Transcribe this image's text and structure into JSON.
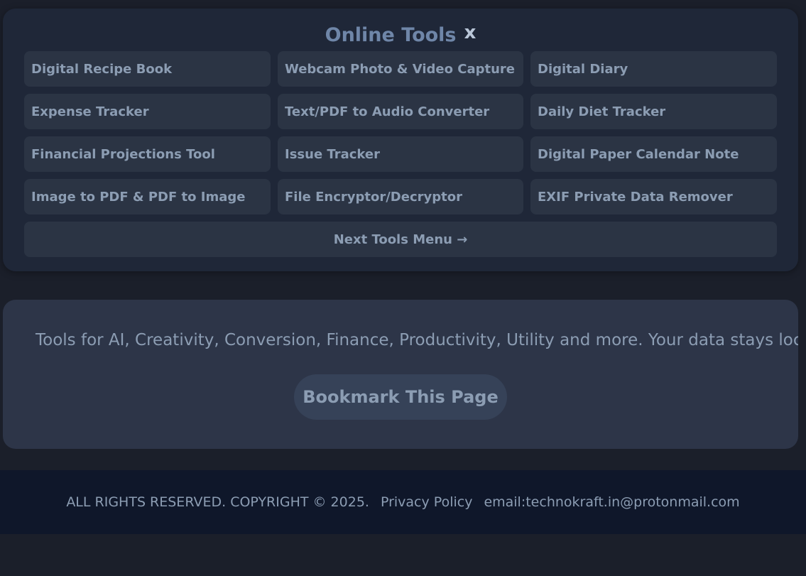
{
  "tools": {
    "title": "Online Tools",
    "close_label": "x",
    "items": [
      "Digital Recipe Book",
      "Webcam Photo & Video Capture",
      "Digital Diary",
      "Expense Tracker",
      "Text/PDF to Audio Converter",
      "Daily Diet Tracker",
      "Financial Projections Tool",
      "Issue Tracker",
      "Digital Paper Calendar Note",
      "Image to PDF & PDF to Image",
      "File Encryptor/Decryptor",
      "EXIF Private Data Remover"
    ],
    "next_label": "Next Tools Menu →"
  },
  "info": {
    "tagline": "Tools for AI, Creativity, Conversion, Finance, Productivity, Utility and more. Your data stays loca",
    "bookmark_label": "Bookmark This Page"
  },
  "footer": {
    "copyright": "ALL RIGHTS RESERVED. COPYRIGHT © 2025.",
    "privacy_label": "Privacy Policy",
    "email": "email:technokraft.in@protonmail.com"
  },
  "colors": {
    "page_bg": "#1b1f2a",
    "panel_bg": "#1f2738",
    "button_bg": "#2b3444",
    "text": "#8c9db3",
    "title": "#6f86a8",
    "footer_bg": "#0f172a"
  }
}
